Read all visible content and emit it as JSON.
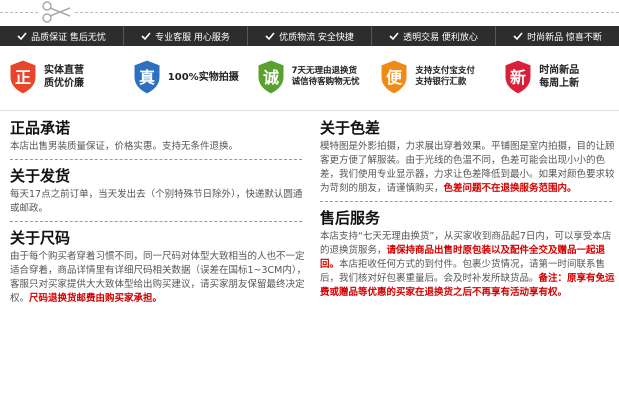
{
  "service_bar": [
    {
      "label": "品质保证  售后无忧"
    },
    {
      "label": "专业客服  用心服务"
    },
    {
      "label": "优质物流  安全快捷"
    },
    {
      "label": "透明交易  便利放心"
    },
    {
      "label": "时尚新品  惊喜不断"
    }
  ],
  "badges": [
    {
      "glyph": "正",
      "line1": "实体直营",
      "line2": "质优价廉",
      "color": "#e8462a"
    },
    {
      "glyph": "真",
      "line1": "100%实物拍摄",
      "line2": "",
      "color": "#2d6fc0"
    },
    {
      "glyph": "诚",
      "line1": "7天无理由退换货",
      "line2": "诚信待客购物无忧",
      "color": "#5aa02c"
    },
    {
      "glyph": "便",
      "line1": "支持支付宝支付",
      "line2": "支持银行汇款",
      "color": "#f08a16"
    },
    {
      "glyph": "新",
      "line1": "时尚新品",
      "line2": "每周上新",
      "color": "#d8203a"
    }
  ],
  "left": {
    "s1_title": "正品承诺",
    "s1_body": "本店出售男装质量保证，价格实惠。支持无条件退换。",
    "s2_title": "关于发货",
    "s2_body": "每天17点之前订单，当天发出去（个别特殊节日除外），快递默认圆通或邮政。",
    "s3_title": "关于尺码",
    "s3_body": "由于每个购买者穿着习惯不同，同一尺码对体型大致相当的人也不一定适合穿着，商品详情里有详细尺码相关数据（误差在国标1~3CM内），客服只对买家提供大大致体型给出购买建议，请买家朋友保留最终决定权。",
    "s3_red": "尺码退换货邮费由购买家承担。"
  },
  "right": {
    "s1_title": "关于色差",
    "s1_body": "模特图是外影拍摄，力求展出穿着效果。平铺图是室内拍摄，目的让顾客更方便了解服装。由于光线的色温不同，色差可能会出现小小的色差，我们使用专业显示器，力求让色差降低到最小。如果对颜色要求较为苛刻的朋友，请谨慎购买，",
    "s1_red": "色差问题不在退换服务范围内。",
    "s2_title": "售后服务",
    "s2_body_a": "本店支持“七天无理由换货”，从买家收到商品起7日内，可以享受本店的退换货服务，",
    "s2_red_a": "请保持商品出售时原包装以及配件全交及赠品一起退回。",
    "s2_body_b": "本店拒收任何方式的到付件。包裹少货情况，请第一时间联系售后，我们核对好包裹重量后。会及时补发所缺货品。",
    "s2_red_b": "备注：原享有免运费或赠品等优惠的买家在退换货之后不再享有活动享有权。"
  }
}
